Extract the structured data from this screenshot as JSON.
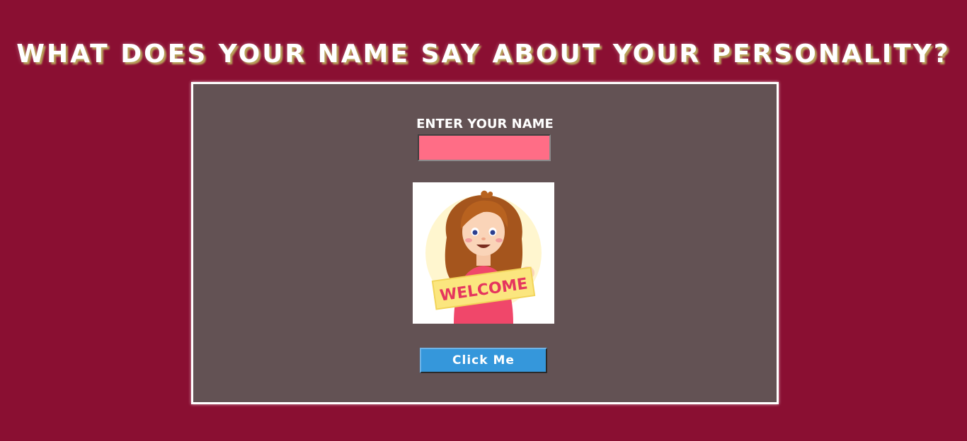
{
  "page": {
    "title": "What does your name say about your personality?"
  },
  "form": {
    "name_label": "ENTER YOUR NAME",
    "name_value": "",
    "name_placeholder": "",
    "button_label": "Click Me"
  },
  "image": {
    "alt": "WELCOME",
    "sign_text": "WELCOME"
  },
  "colors": {
    "background": "#8a0f32",
    "panel": "#635254",
    "input": "#ff6d86",
    "button": "#3597db"
  }
}
